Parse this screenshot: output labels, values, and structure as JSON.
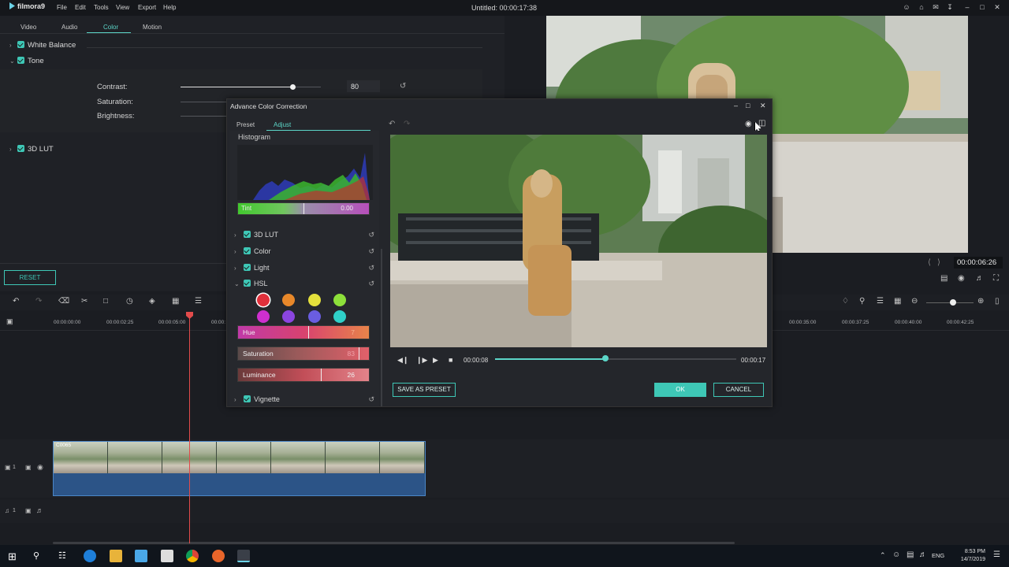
{
  "app": {
    "logo": "filmora9",
    "menu": [
      "File",
      "Edit",
      "Tools",
      "View",
      "Export",
      "Help"
    ],
    "window_title": "Untitled:  00:00:17:38"
  },
  "property_panel": {
    "tabs": [
      "Video",
      "Audio",
      "Color",
      "Motion"
    ],
    "active_tab": "Color",
    "sections": [
      {
        "label": "White Balance"
      },
      {
        "label": "Tone"
      },
      {
        "label": "3D LUT"
      }
    ],
    "contrast_label": "Contrast:",
    "contrast_value": "80",
    "contrast_level": 0.8,
    "saturation_label": "Saturation:",
    "brightness_label": "Brightness:",
    "reset_label": "RESET"
  },
  "preview": {
    "timecode": "00:00:06:26"
  },
  "timeline": {
    "ruler": [
      "00:00:00:00",
      "00:00:02:25",
      "00:00:05:00",
      "00:00:",
      "00:00:35:00",
      "00:00:37:25",
      "00:00:40:00",
      "00:00:42:25"
    ],
    "clip_name": "C0065",
    "track_video_label": "1",
    "track_audio_label": "1"
  },
  "dialog": {
    "title": "Advance Color Correction",
    "tabs": [
      "Preset",
      "Adjust"
    ],
    "active_tab": "Adjust",
    "histogram_label": "Histogram",
    "tint_label": "Tint",
    "tint_value": "0.00",
    "sections": [
      {
        "label": "3D LUT"
      },
      {
        "label": "Color"
      },
      {
        "label": "Light"
      },
      {
        "label": "HSL"
      },
      {
        "label": "Vignette"
      }
    ],
    "hsl_swatches": [
      "#e0303b",
      "#e8882a",
      "#e4e03c",
      "#8de03a",
      "#cf2fcf",
      "#8b45e0",
      "#6a5de0",
      "#2fd0c8"
    ],
    "hsl": {
      "hue_label": "Hue",
      "hue_value": "7",
      "saturation_label": "Saturation",
      "saturation_value": "83",
      "luminance_label": "Luminance",
      "luminance_value": "26"
    },
    "player": {
      "current": "00:00:08",
      "total": "00:00:17"
    },
    "save_preset_label": "SAVE AS PRESET",
    "ok_label": "OK",
    "cancel_label": "CANCEL"
  },
  "taskbar": {
    "lang": "ENG",
    "time": "8:53 PM",
    "date": "14/7/2019"
  },
  "colors": {
    "accent": "#3ec7b6",
    "playhead": "#e24b4b"
  }
}
